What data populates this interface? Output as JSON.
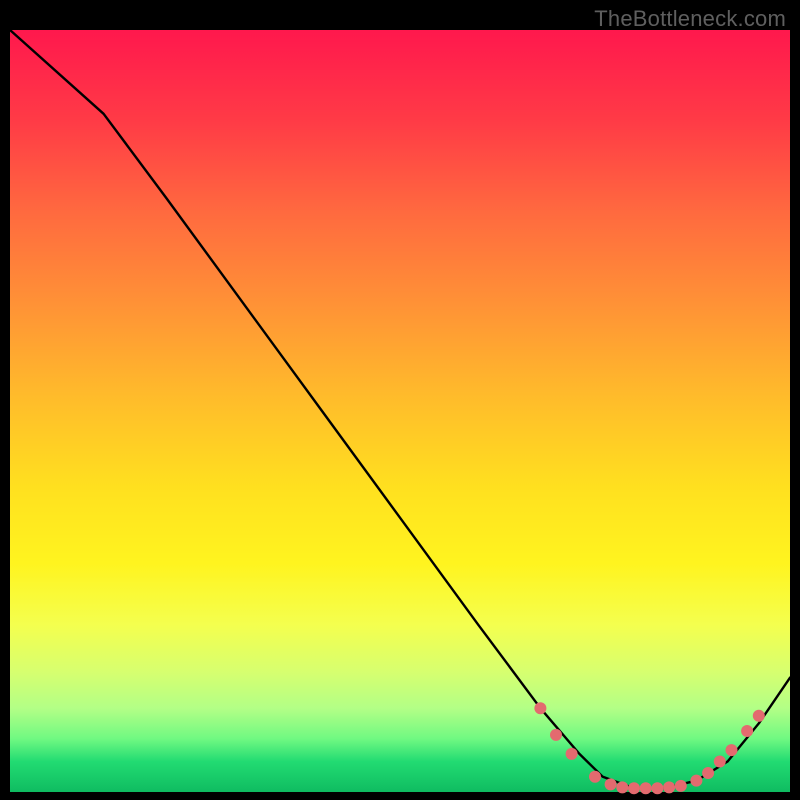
{
  "watermark": "TheBottleneck.com",
  "chart_data": {
    "type": "line",
    "title": "",
    "xlabel": "",
    "ylabel": "",
    "xlim": [
      0,
      100
    ],
    "ylim": [
      0,
      100
    ],
    "grid": false,
    "series": [
      {
        "name": "curve",
        "x": [
          0,
          12,
          20,
          30,
          40,
          50,
          60,
          68,
          73,
          76,
          80,
          84,
          88,
          92,
          96,
          100
        ],
        "y": [
          100,
          89,
          78,
          64,
          50,
          36,
          22,
          11,
          5,
          2,
          0.5,
          0.5,
          1.5,
          4,
          9,
          15
        ]
      }
    ],
    "points": [
      {
        "x": 68.0,
        "y": 11.0
      },
      {
        "x": 70.0,
        "y": 7.5
      },
      {
        "x": 72.0,
        "y": 5.0
      },
      {
        "x": 75.0,
        "y": 2.0
      },
      {
        "x": 77.0,
        "y": 1.0
      },
      {
        "x": 78.5,
        "y": 0.6
      },
      {
        "x": 80.0,
        "y": 0.5
      },
      {
        "x": 81.5,
        "y": 0.5
      },
      {
        "x": 83.0,
        "y": 0.5
      },
      {
        "x": 84.5,
        "y": 0.6
      },
      {
        "x": 86.0,
        "y": 0.8
      },
      {
        "x": 88.0,
        "y": 1.5
      },
      {
        "x": 89.5,
        "y": 2.5
      },
      {
        "x": 91.0,
        "y": 4.0
      },
      {
        "x": 92.5,
        "y": 5.5
      },
      {
        "x": 94.5,
        "y": 8.0
      },
      {
        "x": 96.0,
        "y": 10.0
      }
    ],
    "colors": {
      "top": "#ff184d",
      "bottom": "#0fbc61",
      "line": "#000000",
      "points": "#e36a6f"
    }
  }
}
